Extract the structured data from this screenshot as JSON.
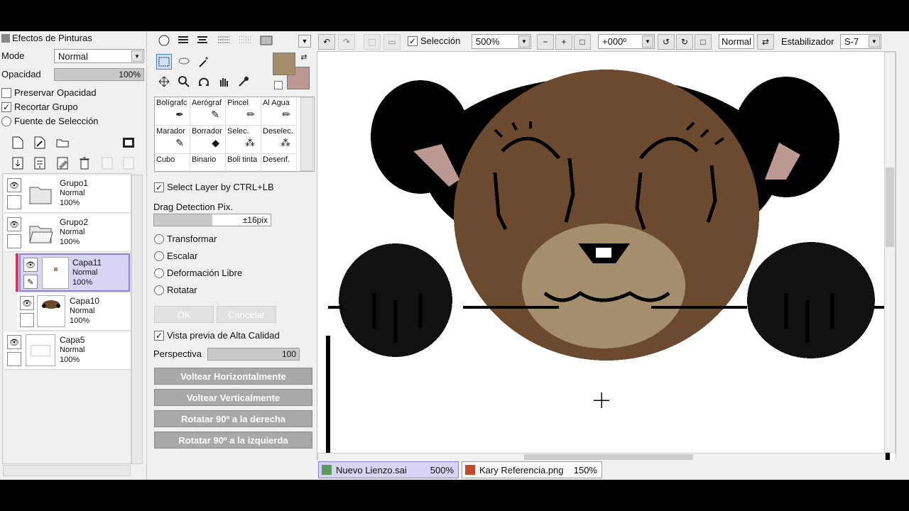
{
  "left_panel": {
    "title": "Efectos de Pinturas",
    "mode_label": "Mode",
    "mode_value": "Normal",
    "opacity_label": "Opacidad",
    "opacity_value": "100%",
    "opacity_fraction": 1.0,
    "preserve_opacity": "Preservar Opacidad",
    "clip_group": "Recortar Grupo",
    "selection_source": "Fuente de Selección",
    "layers": [
      {
        "name": "Grupo1",
        "mode": "Normal",
        "opacity": "100%",
        "type": "folder"
      },
      {
        "name": "Grupo2",
        "mode": "Normal",
        "opacity": "100%",
        "type": "folder"
      },
      {
        "name": "Capa11",
        "mode": "Normal",
        "opacity": "100%",
        "type": "layer",
        "selected": true
      },
      {
        "name": "Capa10",
        "mode": "Normal",
        "opacity": "100%",
        "type": "layer"
      },
      {
        "name": "Capa5",
        "mode": "Normal",
        "opacity": "100%",
        "type": "layer"
      }
    ]
  },
  "tools": {
    "brushes": [
      "Bolígrafc",
      "Aerógraf",
      "Pincel",
      "Al Agua",
      "Marador",
      "Borrador",
      "Selec.",
      "Deselec.",
      "Cubo",
      "Binario",
      "Boli tinta",
      "Desenf."
    ],
    "select_layer": "Select Layer by CTRL+LB",
    "drag_label": "Drag Detection Pix.",
    "drag_value": "±16pix",
    "transform_options": [
      "Transformar",
      "Escalar",
      "Deformación Libre",
      "Rotatar"
    ],
    "ok": "OK",
    "cancel": "Cancelar",
    "hq_preview": "Vista previa de Alta Calidad",
    "perspective_label": "Perspectiva",
    "perspective_value": "100",
    "flip_h": "Voltear Horizontalmente",
    "flip_v": "Voltear Verticalmente",
    "rotate_right": "Rotatar 90º a la derecha",
    "rotate_left": "Rotatar 90º a la izquierda",
    "main_color": "#a58e6b",
    "sub_color": "#bb9891"
  },
  "toolbar": {
    "selection": "Selección",
    "zoom": "500%",
    "angle": "+000º",
    "blend": "Normal",
    "stabilizer_label": "Estabilizador",
    "stabilizer_value": "S-7"
  },
  "tabs": [
    {
      "name": "Nuevo Lienzo.sai",
      "zoom": "500%",
      "active": true
    },
    {
      "name": "Kary Referencia.png",
      "zoom": "150%",
      "active": false
    }
  ]
}
